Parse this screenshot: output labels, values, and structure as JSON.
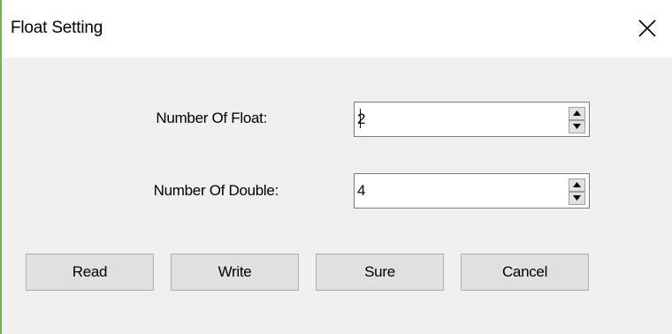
{
  "window": {
    "title": "Float Setting",
    "close_icon": "close-icon"
  },
  "fields": {
    "float": {
      "label": "Number Of Float:",
      "value": "2"
    },
    "double": {
      "label": "Number Of Double:",
      "value": "4"
    }
  },
  "buttons": {
    "read": "Read",
    "write": "Write",
    "sure": "Sure",
    "cancel": "Cancel"
  },
  "colors": {
    "window_background": "#f0f0f0",
    "titlebar_background": "#ffffff",
    "button_face": "#e1e1e1",
    "accent_border": "#6fb25a"
  }
}
